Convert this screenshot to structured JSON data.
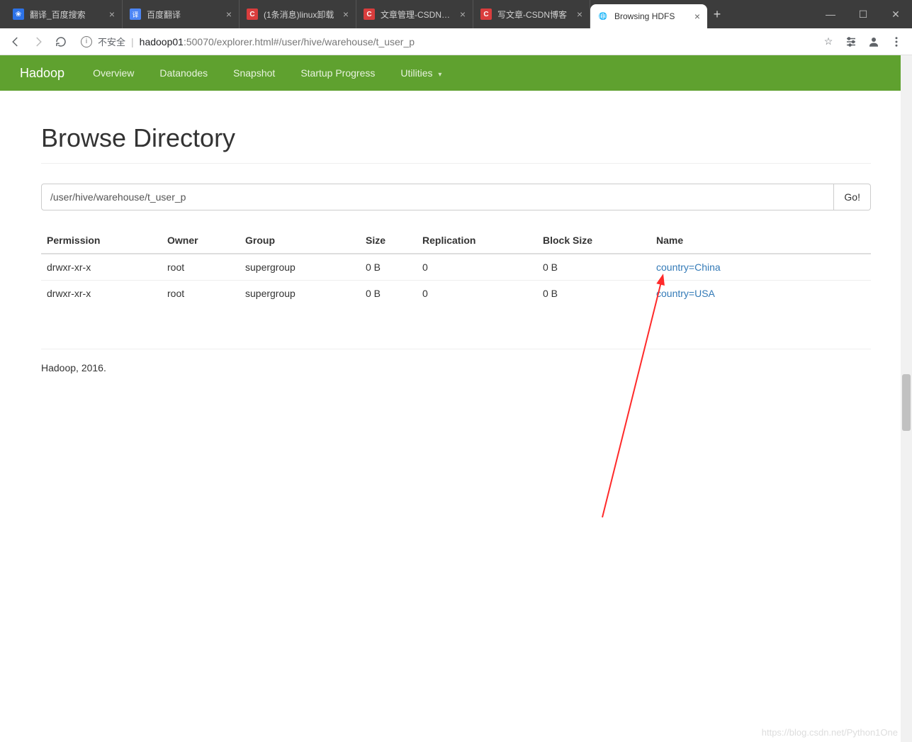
{
  "browser": {
    "tabs": [
      {
        "title": "翻译_百度搜索",
        "favicon": "baidu",
        "faviconGlyph": "❀"
      },
      {
        "title": "百度翻译",
        "favicon": "fanyi",
        "faviconGlyph": "译"
      },
      {
        "title": "(1条消息)linux卸载",
        "favicon": "csdn",
        "faviconGlyph": "C"
      },
      {
        "title": "文章管理-CSDN博客",
        "favicon": "csdn",
        "faviconGlyph": "C"
      },
      {
        "title": "写文章-CSDN博客",
        "favicon": "csdn",
        "faviconGlyph": "C"
      },
      {
        "title": "Browsing HDFS",
        "favicon": "globe",
        "faviconGlyph": "🌐",
        "active": true
      }
    ],
    "newTabGlyph": "+",
    "windowControls": {
      "minimize": "—",
      "maximize": "☐",
      "close": "✕"
    },
    "address": {
      "securityLabel": "不安全",
      "host": "hadoop01",
      "rest": ":50070/explorer.html#/user/hive/warehouse/t_user_p"
    },
    "toolbarIcons": {
      "star": "☆"
    }
  },
  "navbar": {
    "brand": "Hadoop",
    "items": [
      "Overview",
      "Datanodes",
      "Snapshot",
      "Startup Progress"
    ],
    "utilities": "Utilities"
  },
  "page": {
    "title": "Browse Directory",
    "pathValue": "/user/hive/warehouse/t_user_p",
    "goLabel": "Go!",
    "columns": [
      "Permission",
      "Owner",
      "Group",
      "Size",
      "Replication",
      "Block Size",
      "Name"
    ],
    "rows": [
      {
        "permission": "drwxr-xr-x",
        "owner": "root",
        "group": "supergroup",
        "size": "0 B",
        "replication": "0",
        "blockSize": "0 B",
        "name": "country=China"
      },
      {
        "permission": "drwxr-xr-x",
        "owner": "root",
        "group": "supergroup",
        "size": "0 B",
        "replication": "0",
        "blockSize": "0 B",
        "name": "country=USA"
      }
    ],
    "footer": "Hadoop, 2016."
  },
  "watermark": "https://blog.csdn.net/Python1One"
}
